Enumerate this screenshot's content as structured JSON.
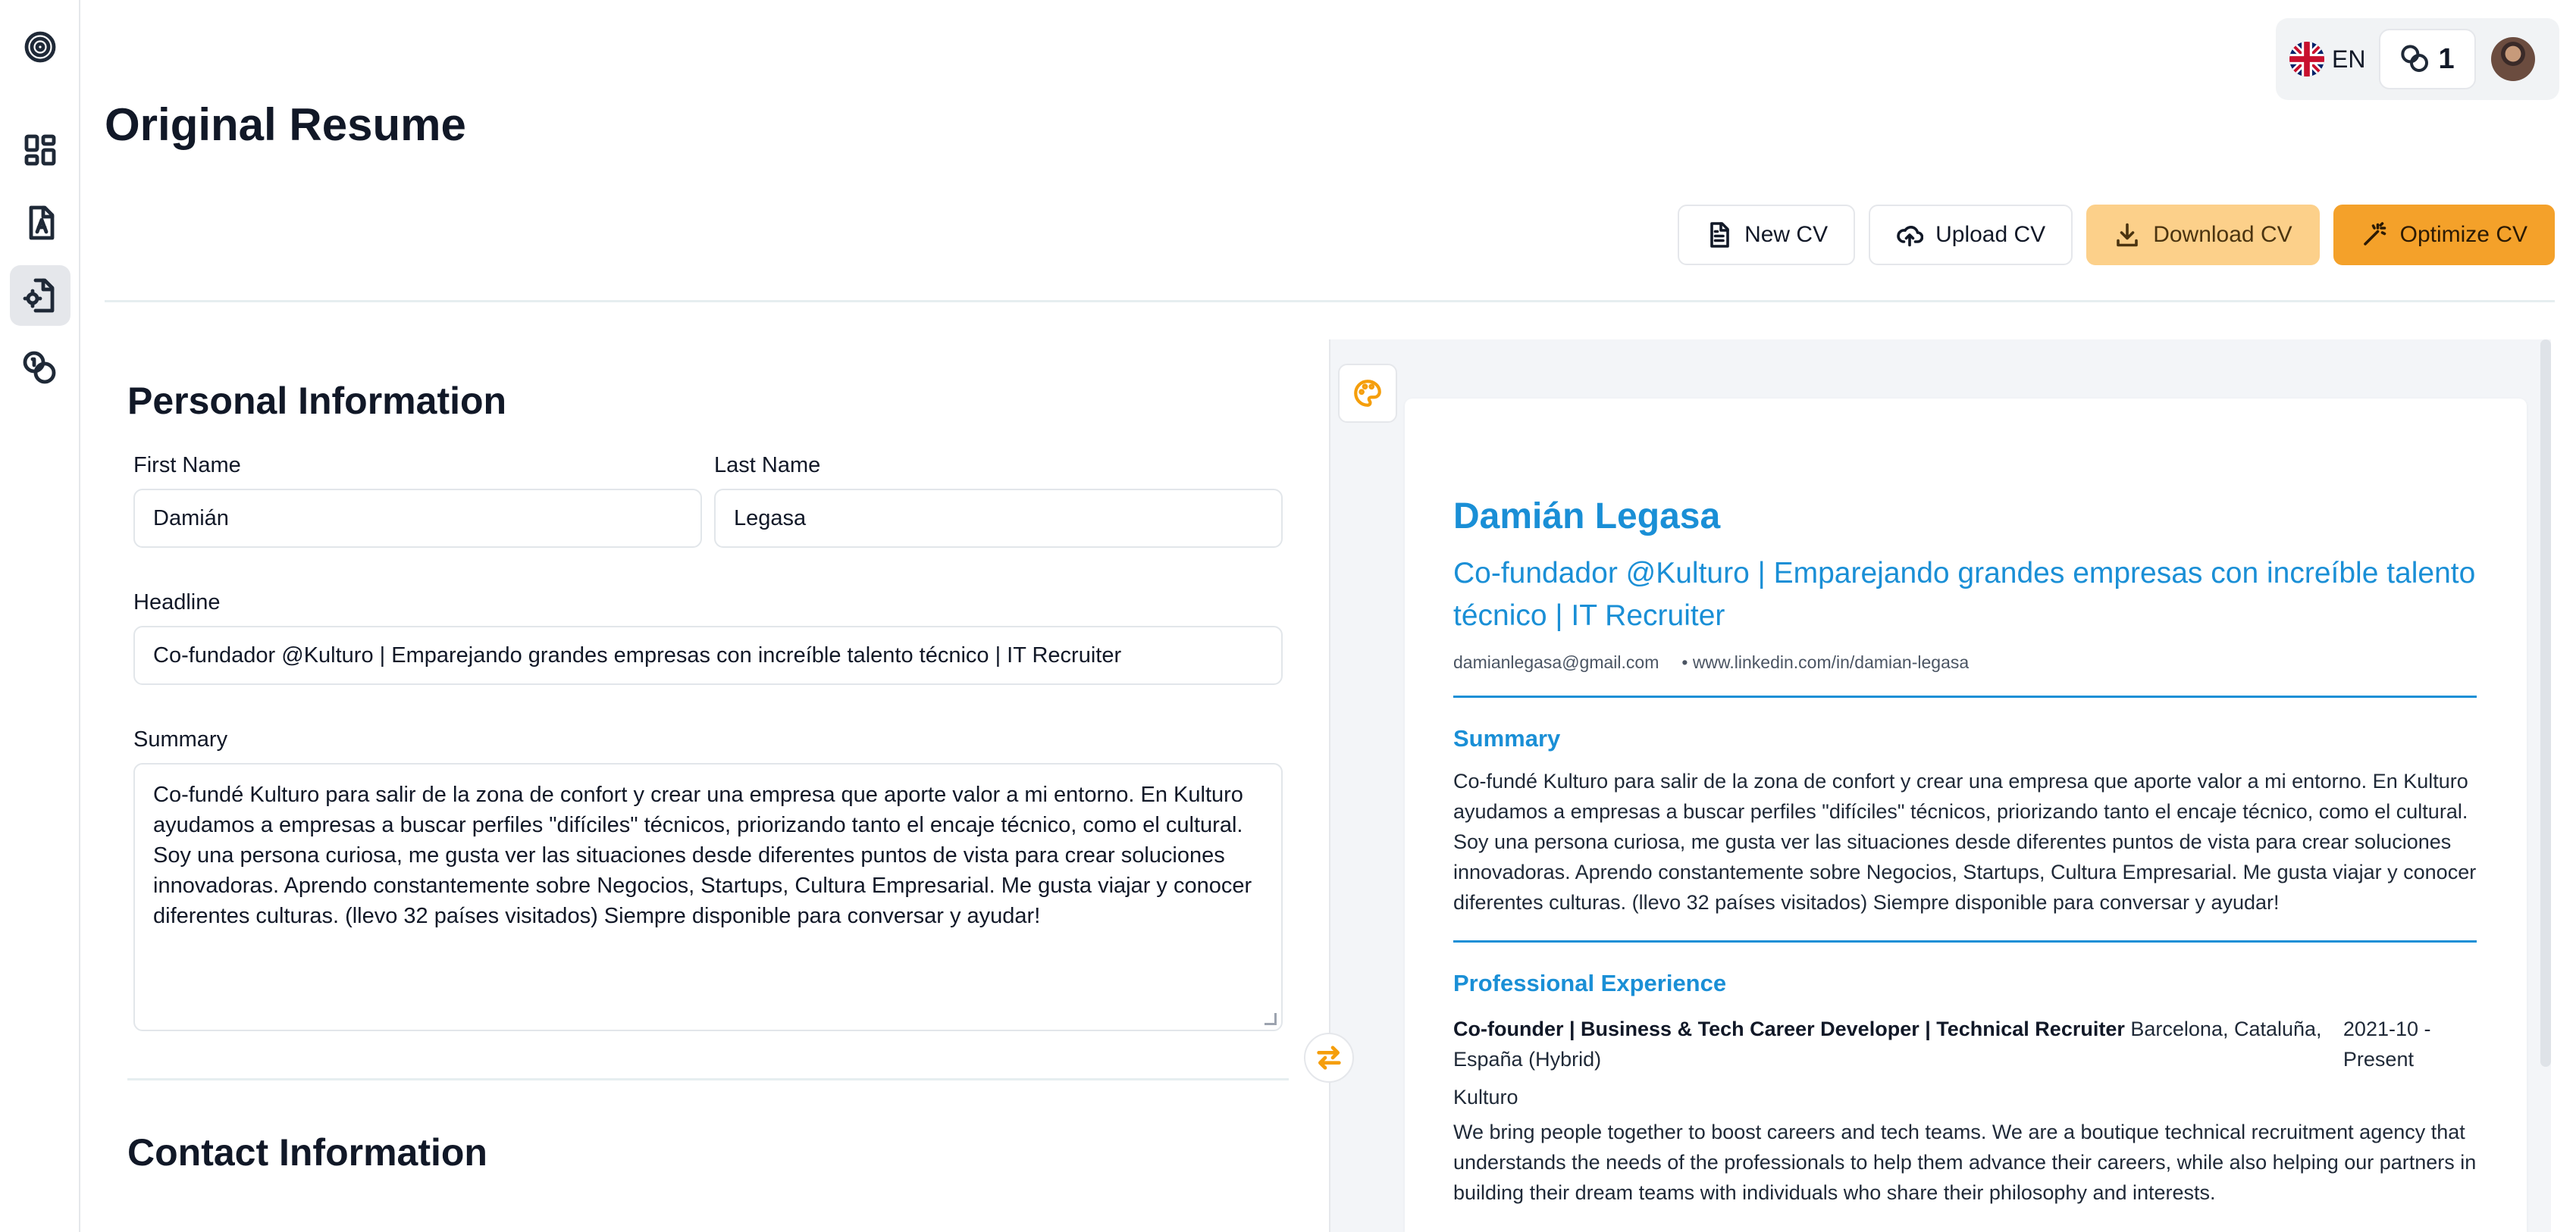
{
  "sidebar": {
    "items": [
      {
        "icon": "target-logo-icon"
      },
      {
        "icon": "dashboard-icon"
      },
      {
        "icon": "resume-icon"
      },
      {
        "icon": "document-settings-icon",
        "active": true
      },
      {
        "icon": "coins-icon"
      }
    ]
  },
  "topbar": {
    "language": "EN",
    "credits": "1"
  },
  "page": {
    "title": "Original Resume"
  },
  "actions": {
    "new_cv": "New CV",
    "upload_cv": "Upload CV",
    "download_cv": "Download CV",
    "optimize_cv": "Optimize CV"
  },
  "form": {
    "personal_title": "Personal Information",
    "first_name_label": "First Name",
    "first_name_value": "Damián",
    "last_name_label": "Last Name",
    "last_name_value": "Legasa",
    "headline_label": "Headline",
    "headline_value": "Co-fundador @Kulturo | Emparejando grandes empresas con increíble talento técnico | IT Recruiter",
    "summary_label": "Summary",
    "summary_value": "Co-fundé Kulturo para salir de la zona de confort y crear una empresa que aporte valor a mi entorno. En Kulturo ayudamos a empresas a buscar perfiles \"difíciles\" técnicos, priorizando tanto el encaje técnico, como el cultural. Soy una persona curiosa, me gusta ver las situaciones desde diferentes puntos de vista para crear soluciones innovadoras. Aprendo constantemente sobre Negocios, Startups, Cultura Empresarial. Me gusta viajar y conocer diferentes culturas. (llevo 32 países visitados) Siempre disponible para conversar y ayudar!",
    "contact_title": "Contact Information"
  },
  "preview": {
    "name": "Damián Legasa",
    "headline": "Co-fundador @Kulturo | Emparejando grandes empresas con increíble talento técnico | IT Recruiter",
    "email": "damianlegasa@gmail.com",
    "linkedin": "• www.linkedin.com/in/damian-legasa",
    "summary_title": "Summary",
    "summary_text": "Co-fundé Kulturo para salir de la zona de confort y crear una empresa que aporte valor a mi entorno. En Kulturo ayudamos a empresas a buscar perfiles \"difíciles\" técnicos, priorizando tanto el encaje técnico, como el cultural. Soy una persona curiosa, me gusta ver las situaciones desde diferentes puntos de vista para crear soluciones innovadoras. Aprendo constantemente sobre Negocios, Startups, Cultura Empresarial. Me gusta viajar y conocer diferentes culturas. (llevo 32 países visitados) Siempre disponible para conversar y ayudar!",
    "experience_title": "Professional Experience",
    "experience": [
      {
        "role": "Co-founder | Business & Tech Career Developer | Technical Recruiter",
        "location": "Barcelona, Cataluña, España (Hybrid)",
        "dates": "2021-10 - Present",
        "company": "Kulturo",
        "description": "We bring people together to boost careers and tech teams. We are a boutique technical recruitment agency that understands the needs of the professionals to help them advance their careers, while also helping our partners in building their dream teams with individuals who share their philosophy and interests."
      }
    ]
  },
  "colors": {
    "accent": "#1a8fd6",
    "orange": "#f4a12a",
    "orange_light": "#fcd08a"
  }
}
